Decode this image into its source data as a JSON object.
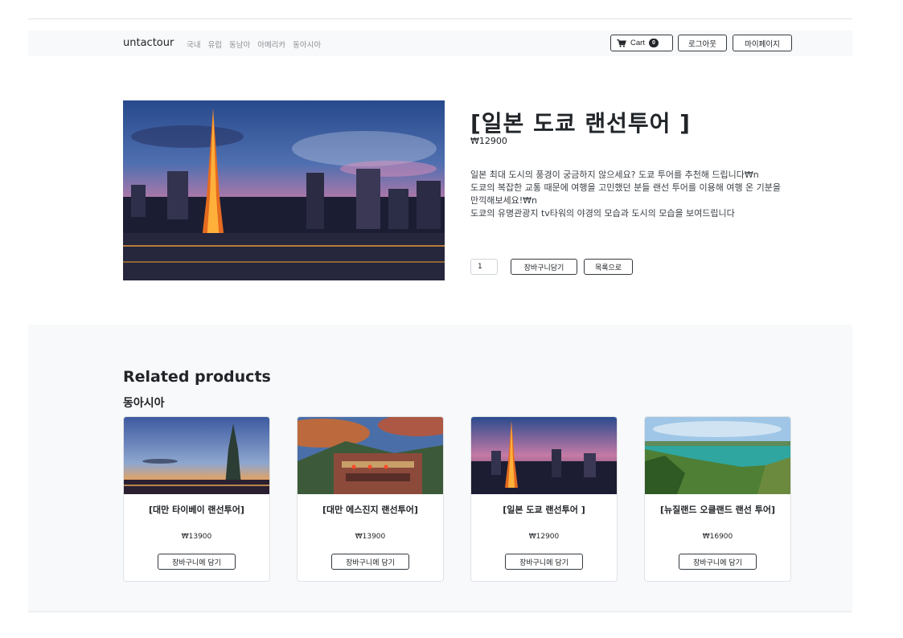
{
  "navbar": {
    "brand": "untactour",
    "links": [
      "국내",
      "유럽",
      "동남아",
      "아메리카",
      "동아시아"
    ],
    "cart_label": "Cart",
    "cart_count": "0",
    "logout_label": "로그아웃",
    "mypage_label": "마이페이지"
  },
  "product": {
    "title": "[일본 도쿄 랜선투어 ]",
    "price": "₩12900",
    "description": [
      "일본 최대 도시의 풍경이 궁금하지 않으세요? 도쿄 투어를 추천해 드립니다₩n",
      "도쿄의 복잡한 교통 때문에 여행을 고민했던 분들 랜선 투어를 이용해 여행 온 기분을 만끽해보세요!₩n",
      "도쿄의 유명관광지 tv타워의 야경의 모습과 도시의 모습을 보여드립니다"
    ],
    "quantity": "1",
    "add_to_cart_label": "장바구니담기",
    "back_to_list_label": "목록으로"
  },
  "related": {
    "heading": "Related products",
    "category": "동아시아",
    "items": [
      {
        "title": "[대만 타이베이 랜선투어]",
        "price": "₩13900",
        "button": "장바구니에 담기"
      },
      {
        "title": "[대만 에스진지 랜선투어]",
        "price": "₩13900",
        "button": "장바구니에 담기"
      },
      {
        "title": "[일본 도쿄 랜선투어 ]",
        "price": "₩12900",
        "button": "장바구니에 담기"
      },
      {
        "title": "[뉴질랜드 오클랜드 랜선 투어]",
        "price": "₩16900",
        "button": "장바구니에 담기"
      }
    ]
  },
  "colors": {
    "navbar_bg": "#f8f9fa",
    "section_bg": "#f8f9fa",
    "text": "#212529",
    "button_border": "#343a40"
  }
}
